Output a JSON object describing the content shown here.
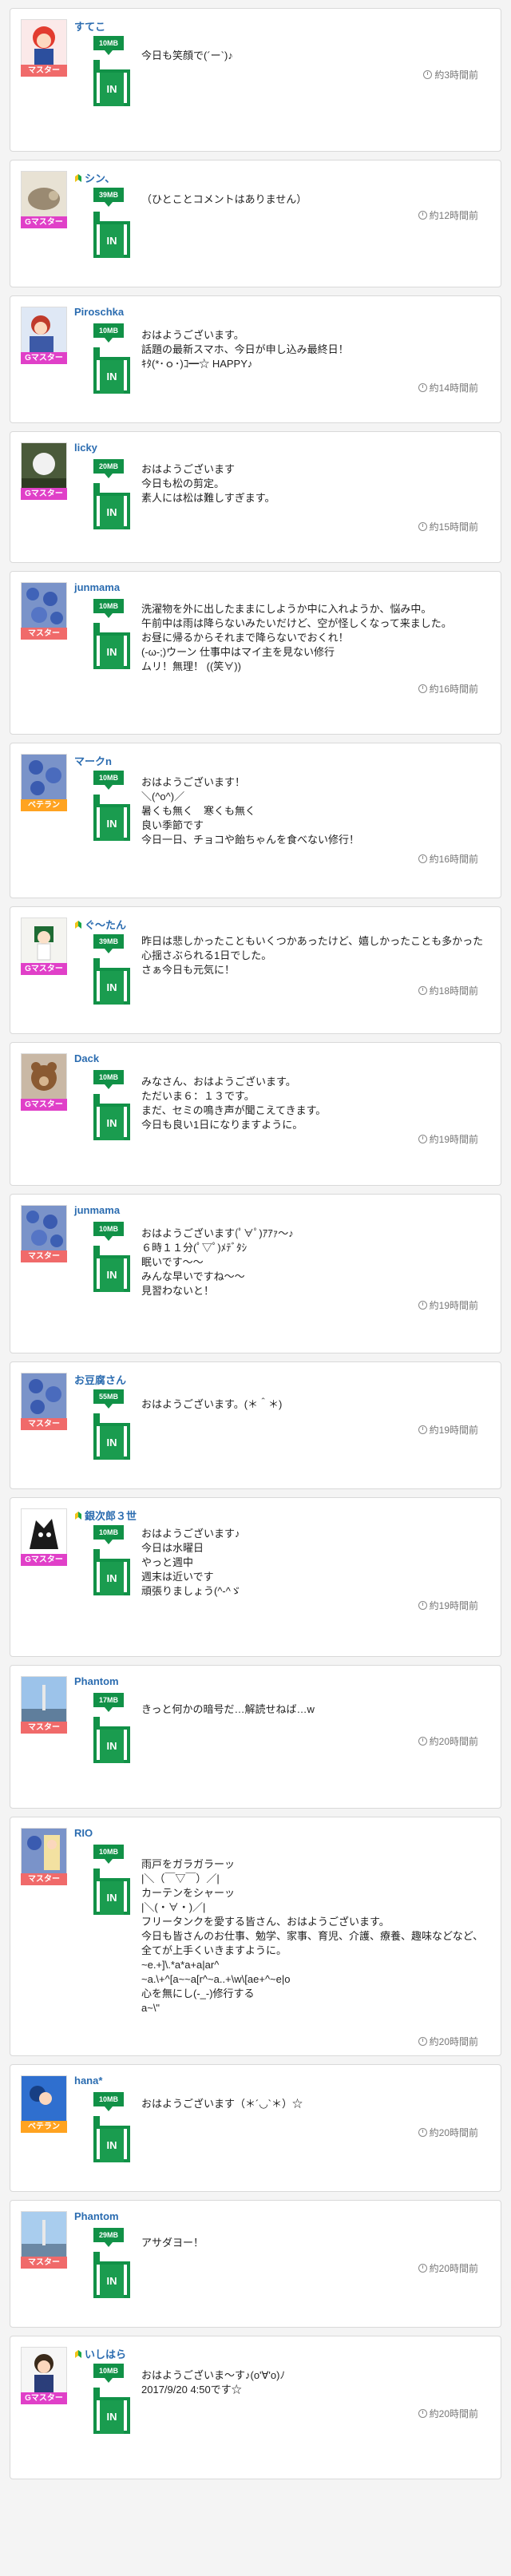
{
  "posts": [
    {
      "name": "すてこ",
      "beginner": false,
      "rank": "マスター",
      "mb": "10MB",
      "in_label": "IN",
      "message": "今日も笑顔で(´ー`)♪",
      "time": "約3時間前"
    },
    {
      "name": "シン、",
      "beginner": true,
      "rank": "Gマスター",
      "mb": "39MB",
      "in_label": "IN",
      "message": "（ひとことコメントはありません）",
      "time": "約12時間前"
    },
    {
      "name": "Piroschka",
      "beginner": false,
      "rank": "Gマスター",
      "mb": "10MB",
      "in_label": "IN",
      "message": "おはようございます。\n話題の最新スマホ、今日が申し込み最終日！\nｷﾀ(*･ｏ･)ｺ━☆ HAPPY♪",
      "time": "約14時間前"
    },
    {
      "name": "licky",
      "beginner": false,
      "rank": "Gマスター",
      "mb": "20MB",
      "in_label": "IN",
      "message": "おはようございます\n今日も松の剪定。\n素人には松は難しすぎます。",
      "time": "約15時間前"
    },
    {
      "name": "junmama",
      "beginner": false,
      "rank": "マスター",
      "mb": "10MB",
      "in_label": "IN",
      "message": "洗濯物を外に出したままにしようか中に入れようか、悩み中。\n午前中は雨は降らないみたいだけど、空が怪しくなって来ました。\nお昼に帰るからそれまで降らないでおくれ！\n(-ω-;)ウーン 仕事中はマイ主を見ない修行\nムリ！無理！ ((笑∀))",
      "time": "約16時間前"
    },
    {
      "name": "マークn",
      "beginner": false,
      "rank": "ベテラン",
      "mb": "10MB",
      "in_label": "IN",
      "message": "おはようございます！\n＼(^o^)／\n暑くも無く　寒くも無く\n良い季節です\n今日一日、チョコや飴ちゃんを食べない修行！",
      "time": "約16時間前"
    },
    {
      "name": "ぐ〜たん",
      "beginner": true,
      "rank": "Gマスター",
      "mb": "39MB",
      "in_label": "IN",
      "message": "昨日は悲しかったこともいくつかあったけど、嬉しかったことも多かった心揺さぶられる1日でした。\nさぁ今日も元気に！",
      "time": "約18時間前"
    },
    {
      "name": "Dack",
      "beginner": false,
      "rank": "Gマスター",
      "mb": "10MB",
      "in_label": "IN",
      "message": "みなさん、おはようございます。\nただいま６：１３です。\nまだ、セミの鳴き声が聞こえてきます。\n今日も良い1日になりますように。",
      "time": "約19時間前"
    },
    {
      "name": "junmama",
      "beginner": false,
      "rank": "マスター",
      "mb": "10MB",
      "in_label": "IN",
      "message": "おはようございます(ﾟ∀ﾟ)ｱｱｧ〜♪\n６時１１分(ﾟ▽ﾟ)ﾒﾃﾞﾀｼ\n眠いです〜〜\nみんな早いですね〜〜\n見習わないと！",
      "time": "約19時間前"
    },
    {
      "name": "お豆腐さん",
      "beginner": false,
      "rank": "マスター",
      "mb": "55MB",
      "in_label": "IN",
      "message": "おはようございます。(＊＾＊)",
      "time": "約19時間前"
    },
    {
      "name": "銀次郎３世",
      "beginner": true,
      "rank": "Gマスター",
      "mb": "10MB",
      "in_label": "IN",
      "message": "おはようございます♪\n今日は水曜日\nやっと週中\n週末は近いです\n頑張りましょう(^-^ゞ",
      "time": "約19時間前"
    },
    {
      "name": "Phantom",
      "beginner": false,
      "rank": "マスター",
      "mb": "17MB",
      "in_label": "IN",
      "message": "きっと何かの暗号だ…解読せねば…w",
      "time": "約20時間前"
    },
    {
      "name": "RIO",
      "beginner": false,
      "rank": "マスター",
      "mb": "10MB",
      "in_label": "IN",
      "message": "雨戸をガラガラーッ\n|＼（￣▽￣）／|\nカーテンをシャーッ\n|＼(・∀・)／|\nフリータンクを愛する皆さん、おはようございます。\n今日も皆さんのお仕事、勉学、家事、育児、介護、療養、趣味などなど、全てが上手くいきますように。\n~e.+]\\.*a*a+a|ar^\n~a.\\+^[a~~a[r^~a..+\\w\\[ae+^~e|o\n心を無にし(-_-)修行する\na~\\\"",
      "time": "約20時間前"
    },
    {
      "name": "hana*",
      "beginner": false,
      "rank": "ベテラン",
      "mb": "10MB",
      "in_label": "IN",
      "message": "おはようございます（＊´◡`＊）☆",
      "time": "約20時間前"
    },
    {
      "name": "Phantom",
      "beginner": false,
      "rank": "マスター",
      "mb": "29MB",
      "in_label": "IN",
      "message": "アサダヨー！",
      "time": "約20時間前"
    },
    {
      "name": "いしはら",
      "beginner": true,
      "rank": "Gマスター",
      "mb": "10MB",
      "in_label": "IN",
      "message": "おはようございま〜す♪(o'∀'o)ﾉ\n2017/9/20 4:50です☆",
      "time": "約20時間前"
    }
  ],
  "colors": {
    "name": "#2b6cb0",
    "green": "#119147",
    "master": "#f06a6a",
    "gmaster": "#e040c8",
    "veteran": "#ffa320"
  },
  "icons": {
    "beginner": "beginner-leaf-icon",
    "clock": "clock-icon"
  }
}
